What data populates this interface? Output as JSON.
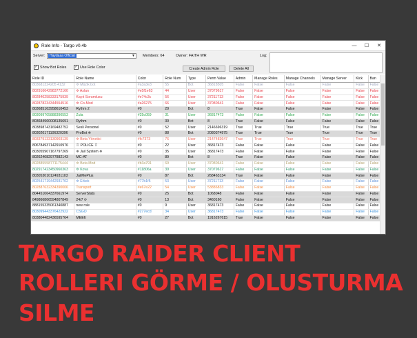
{
  "window": {
    "title": "Role Info - Targo v0.4b",
    "minimize": "—",
    "maximize": "☐",
    "close": "✕"
  },
  "controls": {
    "server_label": "Server:",
    "server_value": "Haydaaa Official",
    "members_label": "Members: 64",
    "owner_label": "Owner: FAITH WR",
    "log_label": "Log:",
    "show_bot_roles": "Show Bot Roles",
    "use_role_color": "Use Role Color",
    "create_admin_role": "Create Admin Role",
    "delete_all": "Delete All",
    "checkmark": "✓"
  },
  "table": {
    "columns": [
      "Role ID",
      "Role Name",
      "Color",
      "Role Num",
      "Type",
      "Perm Value",
      "Admin",
      "Manage Roles",
      "Manage Channels",
      "Manage Server",
      "Kick",
      "Ban"
    ],
    "rows": [
      {
        "c": "#9fa7be",
        "cells": [
          "803681324205 4132",
          "✲ Müzik bot",
          "#a3a3e3",
          "55",
          "Bot",
          "36818505",
          "False",
          "False",
          "False",
          "False",
          "False",
          "False"
        ]
      },
      {
        "c": "#e8404a",
        "cells": [
          "802916642983772160",
          "✲ Aslan",
          "#e5f1e63",
          "44",
          "User",
          "37079617",
          "False",
          "False",
          "False",
          "False",
          "False",
          "False"
        ]
      },
      {
        "c": "#e8404a",
        "cells": [
          "802840258333175939",
          "Kayıt Sorumlusu",
          "#e74c3c",
          "56",
          "User",
          "37211713",
          "False",
          "False",
          "False",
          "False",
          "False",
          "False"
        ]
      },
      {
        "c": "#e8404a",
        "cells": [
          "802878234344554516",
          "✲ Co-Mod",
          "#a26275",
          "66",
          "User",
          "37080641",
          "False",
          "False",
          "False",
          "False",
          "False",
          "False"
        ]
      },
      {
        "c": "#111111",
        "cells": [
          "803685163958610453",
          "Rythm 2",
          "#0",
          "29",
          "Bot",
          "8",
          "True",
          "False",
          "False",
          "False",
          "False",
          "False"
        ]
      },
      {
        "c": "#2fa84f",
        "cells": [
          "803099705888390553",
          "Zula",
          "#25c059",
          "31",
          "User",
          "36817473",
          "False",
          "False",
          "False",
          "False",
          "False",
          "False"
        ]
      },
      {
        "c": "#111111",
        "cells": [
          "803684960008135691",
          "Rythm",
          "#0",
          "30",
          "Bot",
          "8",
          "True",
          "False",
          "False",
          "False",
          "False",
          "False"
        ]
      },
      {
        "c": "#111111",
        "cells": [
          "803898743169482752",
          "Sesli Personel",
          "#0",
          "52",
          "User",
          "2146696319",
          "True",
          "True",
          "True",
          "True",
          "True",
          "True"
        ]
      },
      {
        "c": "#111111",
        "cells": [
          "803020171106320396",
          "ProBot ✲",
          "#0",
          "88",
          "Bot",
          "2080374975",
          "True",
          "True",
          "True",
          "True",
          "True",
          "True"
        ]
      },
      {
        "c": "#f26b5b",
        "cells": [
          "803379133130903139",
          "✲ Beta Yönetici",
          "#fc7373",
          "76",
          "User",
          "2147483647",
          "True",
          "True",
          "True",
          "True",
          "True",
          "True"
        ]
      },
      {
        "c": "#111111",
        "cells": [
          "806784937142910976",
          "♖ POLICE ♖",
          "#0",
          "22",
          "User",
          "36817473",
          "False",
          "False",
          "False",
          "False",
          "False",
          "False"
        ]
      },
      {
        "c": "#111111",
        "cells": [
          "803055907167797269",
          "✵ Jail System ✵",
          "#0",
          "35",
          "User",
          "36817473",
          "False",
          "False",
          "False",
          "False",
          "False",
          "False"
        ]
      },
      {
        "c": "#111111",
        "cells": [
          "802624082977882143",
          "MC-AT",
          "#0",
          "89",
          "Bot",
          "8",
          "True",
          "False",
          "False",
          "False",
          "False",
          "False"
        ]
      },
      {
        "c": "#b3a06a",
        "cells": [
          "802885558771175444",
          "✲ Beta Mod",
          "#b3a791",
          "69",
          "User",
          "37080641",
          "False",
          "False",
          "False",
          "False",
          "False",
          "False"
        ]
      },
      {
        "c": "#2a9a6e",
        "cells": [
          "802917423450960363",
          "✲ Kova",
          "#11806a",
          "39",
          "User",
          "37079617",
          "False",
          "False",
          "False",
          "False",
          "False",
          "False"
        ]
      },
      {
        "c": "#111111",
        "cells": [
          "803053010124931103",
          "JailMePlus",
          "#0",
          "87",
          "Bot",
          "268463134",
          "True",
          "False",
          "False",
          "False",
          "False",
          "False"
        ]
      },
      {
        "c": "#5b8fd8",
        "cells": [
          "802541719442931702",
          "✲ Erkek",
          "#77b1f5",
          "53",
          "User",
          "37211713",
          "False",
          "False",
          "False",
          "False",
          "False",
          "False"
        ]
      },
      {
        "c": "#f0873a",
        "cells": [
          "802887632334390006",
          "Transport",
          "#e67e22",
          "54",
          "User",
          "53886833",
          "False",
          "False",
          "False",
          "False",
          "False",
          "False"
        ]
      },
      {
        "c": "#111111",
        "cells": [
          "804451064337661974",
          "ServerStats",
          "#0",
          "25",
          "Bot",
          "1068048",
          "False",
          "False",
          "False",
          "False",
          "False",
          "False"
        ]
      },
      {
        "c": "#111111",
        "cells": [
          "849866866594807849",
          "24/7 ⟳",
          "#0",
          "13",
          "Bot",
          "3460160",
          "False",
          "False",
          "False",
          "False",
          "False",
          "False"
        ]
      },
      {
        "c": "#111111",
        "cells": [
          "888155335061340887",
          "new role",
          "#0",
          "9",
          "User",
          "36817473",
          "False",
          "False",
          "False",
          "False",
          "False",
          "False"
        ]
      },
      {
        "c": "#3a8fd8",
        "cells": [
          "803099443376422922",
          "CSGO",
          "#277ecd",
          "34",
          "User",
          "36817473",
          "False",
          "False",
          "False",
          "False",
          "False",
          "False"
        ]
      },
      {
        "c": "#111111",
        "cells": [
          "803804482436595764",
          "MEE6",
          "#0",
          "27",
          "Bot",
          "1916267615",
          "True",
          "False",
          "False",
          "False",
          "False",
          "False"
        ]
      }
    ]
  },
  "overlay": {
    "line1": "TARGO RAIDER CLIENT",
    "line2": "ROLLERI GÖRME / OLUSTURMA",
    "line3": "SILME"
  }
}
